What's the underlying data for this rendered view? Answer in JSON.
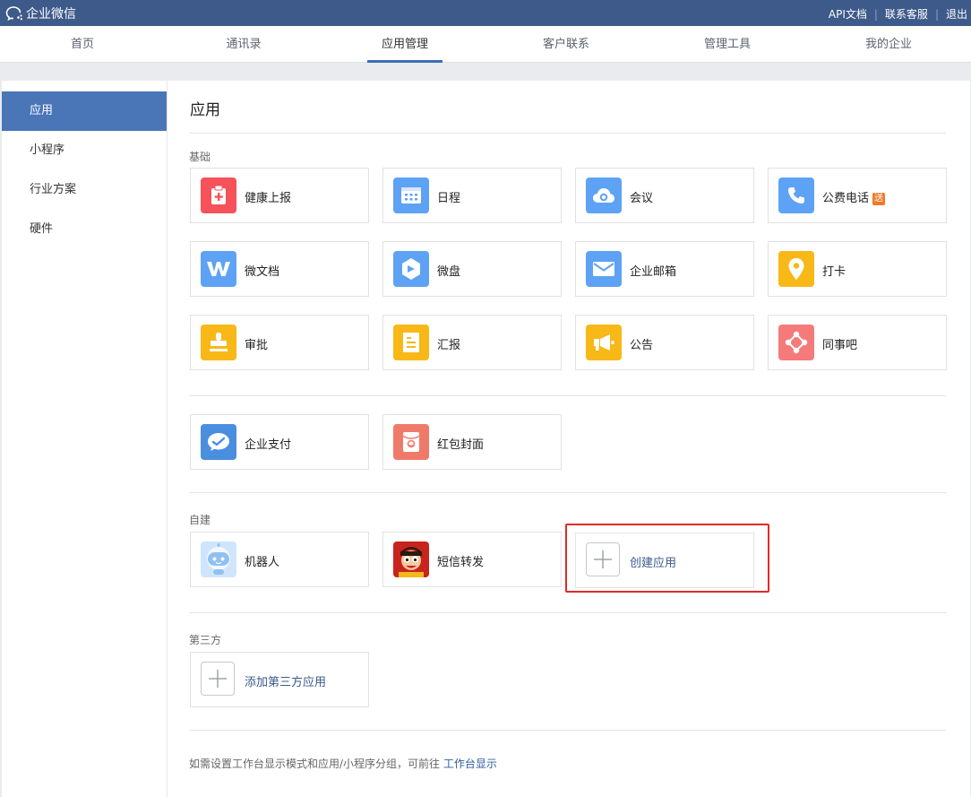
{
  "topbar": {
    "brand": "企业微信",
    "links": [
      "API文档",
      "联系客服",
      "退出"
    ]
  },
  "nav": {
    "tabs": [
      "首页",
      "通讯录",
      "应用管理",
      "客户联系",
      "管理工具",
      "我的企业"
    ],
    "active": "应用管理"
  },
  "sidebar": {
    "items": [
      "应用",
      "小程序",
      "行业方案",
      "硬件"
    ],
    "active": "应用"
  },
  "main": {
    "title": "应用",
    "basic_label": "基础",
    "basic_apps": [
      {
        "label": "健康上报",
        "icon": "health-report-icon",
        "color": "#f5525a"
      },
      {
        "label": "日程",
        "icon": "calendar-icon",
        "color": "#5ea2f5"
      },
      {
        "label": "会议",
        "icon": "meeting-cloud-icon",
        "color": "#5ea2f5"
      },
      {
        "label": "公费电话",
        "icon": "phone-icon",
        "color": "#5ea2f5",
        "badge": "送"
      },
      {
        "label": "微文档",
        "icon": "doc-w-icon",
        "color": "#5ea2f5"
      },
      {
        "label": "微盘",
        "icon": "drive-icon",
        "color": "#5ea2f5"
      },
      {
        "label": "企业邮箱",
        "icon": "mail-icon",
        "color": "#5ea2f5"
      },
      {
        "label": "打卡",
        "icon": "location-pin-icon",
        "color": "#f7b818"
      },
      {
        "label": "审批",
        "icon": "stamp-icon",
        "color": "#f7b818"
      },
      {
        "label": "汇报",
        "icon": "report-icon",
        "color": "#f7b818"
      },
      {
        "label": "公告",
        "icon": "megaphone-icon",
        "color": "#f7b818"
      },
      {
        "label": "同事吧",
        "icon": "colleague-icon",
        "color": "#f57a7a"
      }
    ],
    "extra_apps": [
      {
        "label": "企业支付",
        "icon": "payment-icon",
        "color": "#5ea2f5"
      },
      {
        "label": "红包封面",
        "icon": "red-packet-icon",
        "color": "#f07a6a"
      }
    ],
    "custom_label": "自建",
    "custom_apps": [
      {
        "label": "机器人",
        "icon": "robot-icon"
      },
      {
        "label": "短信转发",
        "icon": "sms-forward-icon"
      }
    ],
    "create_app_label": "创建应用",
    "third_party_label": "第三方",
    "add_third_party_label": "添加第三方应用",
    "footer_text": "如需设置工作台显示模式和应用/小程序分组，可前往",
    "footer_link": "工作台显示"
  }
}
